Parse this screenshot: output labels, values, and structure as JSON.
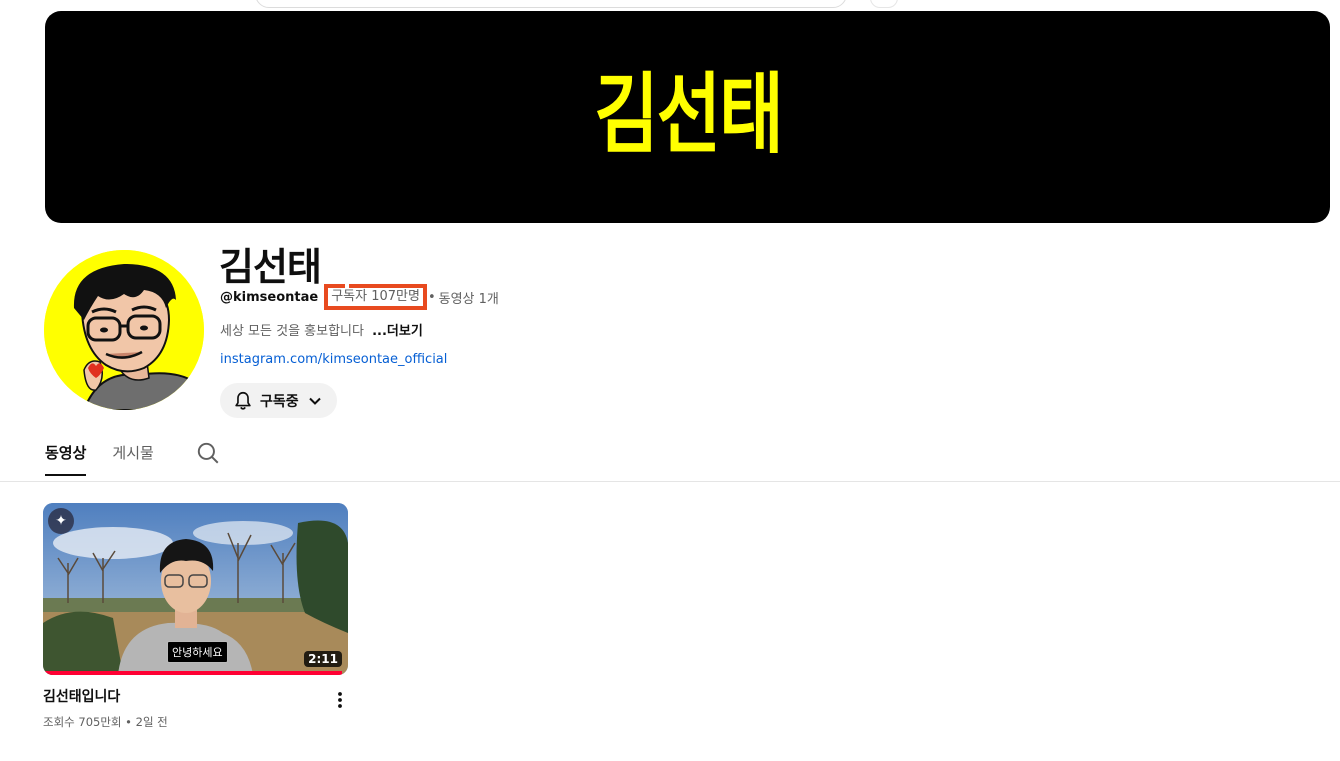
{
  "banner": {
    "logo_text": "김선태",
    "logo_color": "#ffff00",
    "background": "#000000"
  },
  "channel": {
    "name": "김선태",
    "handle": "@kimseontae",
    "subscribers": "구독자 107만명",
    "separator": "•",
    "video_count": "동영상 1개",
    "description": "세상 모든 것을 홍보합니다",
    "more_label": "...더보기",
    "link": "instagram.com/kimseontae_official",
    "subscribe_label": "구독중",
    "highlight_color": "#e84a1f"
  },
  "tabs": [
    {
      "label": "동영상",
      "active": true
    },
    {
      "label": "게시물",
      "active": false
    }
  ],
  "videos": [
    {
      "title": "김선태입니다",
      "views": "조회수 705만회",
      "separator": "•",
      "age": "2일 전",
      "duration": "2:11",
      "caption": "안녕하세요",
      "watched_fraction": 0.98
    }
  ],
  "icons": {
    "bell": "bell-icon",
    "chevron": "chevron-down-icon",
    "search": "search-icon",
    "ai_badge": "sparkle-icon",
    "more": "more-vert-icon"
  }
}
